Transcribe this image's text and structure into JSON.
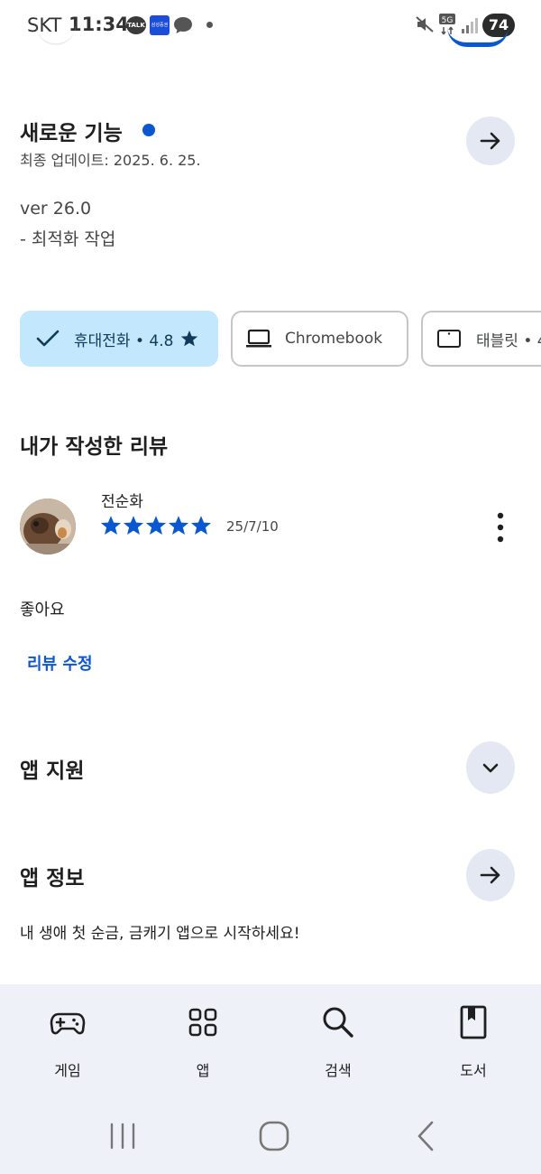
{
  "status_bar": {
    "carrier": "SKT",
    "time": "11:34",
    "talk_badge": "TALK",
    "network": "5G",
    "battery": "74"
  },
  "whats_new": {
    "title": "새로운 기능",
    "updated": "최종 업데이트: 2025. 6. 25.",
    "version": "ver 26.0",
    "notes": "- 최적화 작업"
  },
  "devices": {
    "phone": "휴대전화 • 4.8",
    "chromebook": "Chromebook",
    "tablet": "태블릿 • 4"
  },
  "my_review": {
    "heading": "내가 작성한 리뷰",
    "author": "전순화",
    "rating": 5,
    "date": "25/7/10",
    "text": "좋아요",
    "edit_label": "리뷰 수정"
  },
  "app_support": {
    "heading": "앱 지원"
  },
  "app_info": {
    "heading": "앱 정보",
    "description": "내 생애 첫 순금, 금캐기 앱으로 시작하세요!"
  },
  "bottom_nav": {
    "games": "게임",
    "apps": "앱",
    "search": "검색",
    "books": "도서"
  },
  "colors": {
    "accent": "#0b57d0",
    "chip_selected": "#c3e7fd",
    "nav_bg": "#eef1f7",
    "round_button": "#e3e8f3"
  }
}
